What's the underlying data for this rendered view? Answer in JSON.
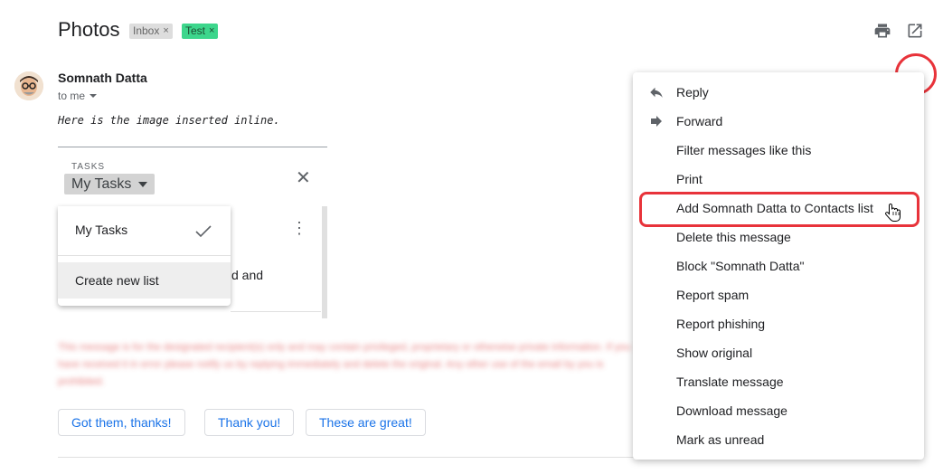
{
  "subject": "Photos",
  "labels": [
    {
      "text": "Inbox",
      "close": "×"
    },
    {
      "text": "Test",
      "close": "×"
    }
  ],
  "sender": {
    "name": "Somnath Datta",
    "to": "to me"
  },
  "body_text": "Here is the image inserted inline.",
  "tasks_widget": {
    "caption": "TASKS",
    "selected_list": "My Tasks",
    "close_glyph": "✕",
    "dropdown": {
      "items": [
        "My Tasks",
        "Create new list"
      ]
    },
    "partial_text": "d and",
    "more_glyph": "⋮"
  },
  "blurred_disclaimer": "This message is for the designated recipient(s) only and may contain privileged, proprietary or otherwise private information. If you have received it in error please notify us by replying immediately and delete the original. Any other use of the email by you is prohibited.",
  "smart_replies": [
    "Got them, thanks!",
    "Thank you!",
    "These are great!"
  ],
  "menu": {
    "items": [
      {
        "label": "Reply",
        "icon": "reply-icon"
      },
      {
        "label": "Forward",
        "icon": "forward-icon"
      },
      {
        "label": "Filter messages like this",
        "icon": ""
      },
      {
        "label": "Print",
        "icon": ""
      },
      {
        "label": "Add Somnath Datta to Contacts list",
        "icon": ""
      },
      {
        "label": "Delete this message",
        "icon": ""
      },
      {
        "label": "Block \"Somnath Datta\"",
        "icon": ""
      },
      {
        "label": "Report spam",
        "icon": ""
      },
      {
        "label": "Report phishing",
        "icon": ""
      },
      {
        "label": "Show original",
        "icon": ""
      },
      {
        "label": "Translate message",
        "icon": ""
      },
      {
        "label": "Download message",
        "icon": ""
      },
      {
        "label": "Mark as unread",
        "icon": ""
      }
    ]
  },
  "colors": {
    "annotation_red": "#e8333a",
    "link_blue": "#1a73e8",
    "label_test_green": "#3dd68c"
  }
}
